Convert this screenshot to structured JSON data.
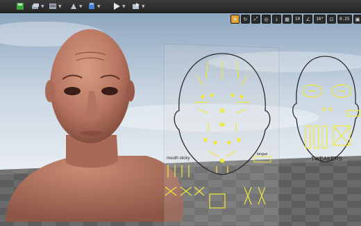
{
  "viewport_toolbar": {
    "translate_snap": "10",
    "rotate_snap": "10°",
    "scale_snap": "0.25"
  },
  "rig_panels": {
    "mouth_sticky": "mouth sticky",
    "tongue": "tongue",
    "tweakers": "TWEAKERS"
  },
  "colors": {
    "rig_yellow": "#f2e83a",
    "active_tool": "#e2a42a"
  }
}
